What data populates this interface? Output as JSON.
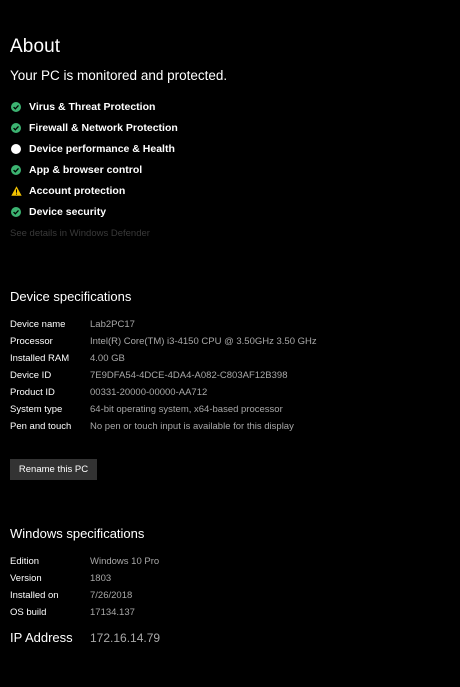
{
  "about": {
    "title": "About",
    "status": "Your PC is monitored and protected.",
    "protections": [
      {
        "label": "Virus & Threat Protection",
        "icon": "check-circle-icon",
        "color": "#3cb371"
      },
      {
        "label": "Firewall & Network Protection",
        "icon": "check-circle-icon",
        "color": "#3cb371"
      },
      {
        "label": "Device performance & Health",
        "icon": "circle-icon",
        "color": "#ffffff"
      },
      {
        "label": "App & browser control",
        "icon": "check-circle-icon",
        "color": "#3cb371"
      },
      {
        "label": "Account protection",
        "icon": "warning-icon",
        "color": "#f2c200"
      },
      {
        "label": "Device security",
        "icon": "check-circle-icon",
        "color": "#3cb371"
      }
    ],
    "defender_link": "See details in Windows Defender"
  },
  "device_specs": {
    "heading": "Device specifications",
    "rows": [
      {
        "key": "Device name",
        "value": "Lab2PC17"
      },
      {
        "key": "Processor",
        "value": "Intel(R) Core(TM) i3-4150 CPU @ 3.50GHz   3.50 GHz"
      },
      {
        "key": "Installed RAM",
        "value": "4.00 GB"
      },
      {
        "key": "Device ID",
        "value": "7E9DFA54-4DCE-4DA4-A082-C803AF12B398"
      },
      {
        "key": "Product ID",
        "value": "00331-20000-00000-AA712"
      },
      {
        "key": "System type",
        "value": "64-bit operating system, x64-based processor"
      },
      {
        "key": "Pen and touch",
        "value": "No pen or touch input is available for this display"
      }
    ],
    "rename_button": "Rename this PC"
  },
  "windows_specs": {
    "heading": "Windows specifications",
    "rows": [
      {
        "key": "Edition",
        "value": "Windows 10 Pro"
      },
      {
        "key": "Version",
        "value": "1803"
      },
      {
        "key": "Installed on",
        "value": "7/26/2018"
      },
      {
        "key": "OS build",
        "value": "17134.137"
      }
    ]
  },
  "ip": {
    "label": "IP Address",
    "value": "172.16.14.79"
  }
}
